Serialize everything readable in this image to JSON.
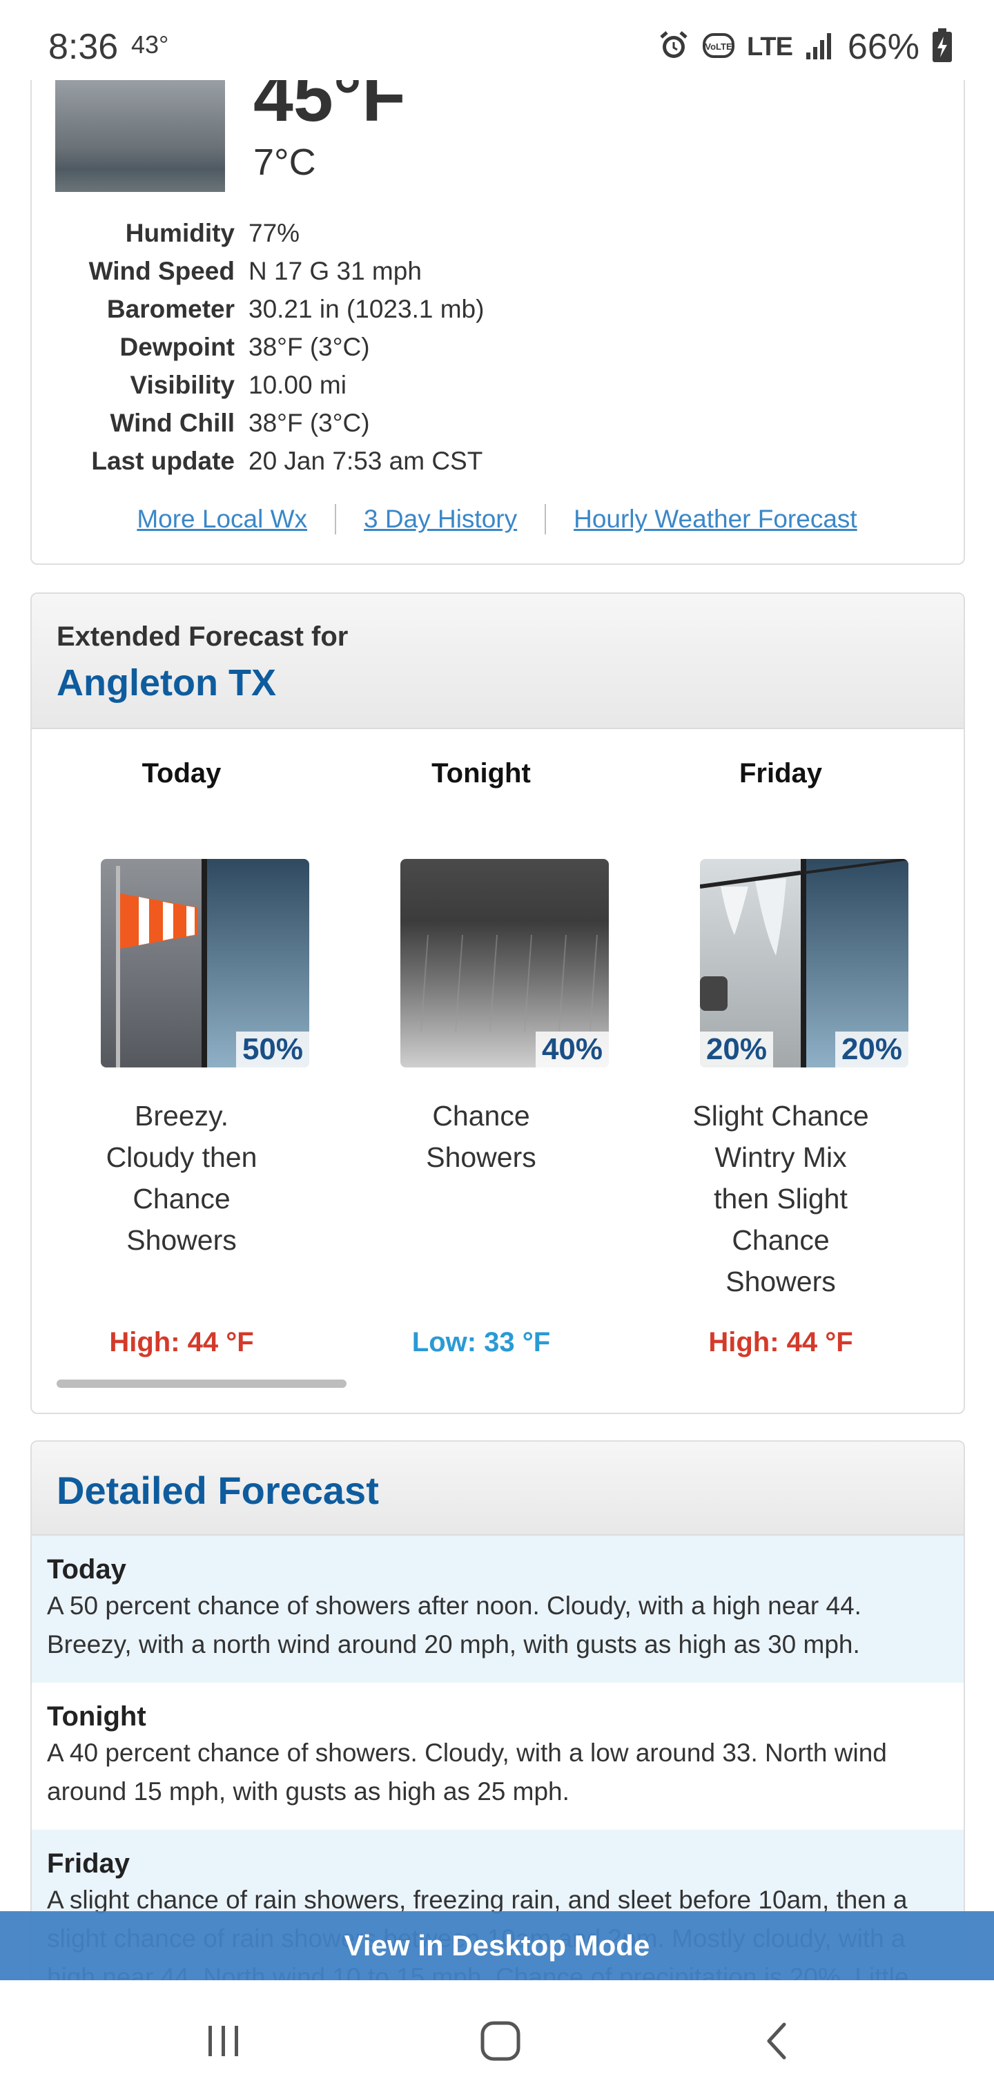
{
  "status_bar": {
    "time": "8:36",
    "temp": "43°",
    "network": "LTE",
    "battery": "66%",
    "volte": "VoLTE"
  },
  "current": {
    "temp_f": "45°F",
    "temp_c": "7°C",
    "details": [
      {
        "label": "Humidity",
        "value": "77%"
      },
      {
        "label": "Wind Speed",
        "value": "N 17 G 31 mph"
      },
      {
        "label": "Barometer",
        "value": "30.21 in (1023.1 mb)"
      },
      {
        "label": "Dewpoint",
        "value": "38°F (3°C)"
      },
      {
        "label": "Visibility",
        "value": "10.00 mi"
      },
      {
        "label": "Wind Chill",
        "value": "38°F (3°C)"
      },
      {
        "label": "Last update",
        "value": "20 Jan 7:53 am CST"
      }
    ],
    "links": [
      "More Local Wx",
      "3 Day History",
      "Hourly Weather Forecast"
    ]
  },
  "extended": {
    "heading": "Extended Forecast for",
    "location": "Angleton TX",
    "periods": [
      {
        "name": "Today",
        "desc_lines": [
          "Breezy.",
          "Cloudy then",
          "Chance",
          "Showers"
        ],
        "pops": [
          "50%"
        ],
        "temp": "High: 44 °F",
        "kind": "hi"
      },
      {
        "name": "Tonight",
        "desc_lines": [
          "Chance",
          "Showers"
        ],
        "pops": [
          "40%"
        ],
        "temp": "Low: 33 °F",
        "kind": "lo"
      },
      {
        "name": "Friday",
        "desc_lines": [
          "Slight Chance",
          "Wintry Mix",
          "then Slight",
          "Chance",
          "Showers"
        ],
        "pops": [
          "20%",
          "20%"
        ],
        "temp": "High: 44 °F",
        "kind": "hi"
      }
    ]
  },
  "detailed": {
    "title": "Detailed Forecast",
    "rows": [
      {
        "name": "Today",
        "text": "A 50 percent chance of showers after noon. Cloudy, with a high near 44. Breezy, with a north wind around 20 mph, with gusts as high as 30 mph."
      },
      {
        "name": "Tonight",
        "text": "A 40 percent chance of showers. Cloudy, with a low around 33. North wind around 15 mph, with gusts as high as 25 mph."
      },
      {
        "name": "Friday",
        "text": "A slight chance of rain showers, freezing rain, and sleet before 10am, then a slight chance of rain showers between 10am and 2pm. Mostly cloudy, with a high near 44. North wind 10 to 15 mph. Chance of precipitation is 20%. Little"
      }
    ]
  },
  "desktop_mode_label": "View in Desktop Mode",
  "colors": {
    "link": "#3a87c8",
    "location": "#0e5c9e",
    "high": "#d43a2a",
    "low": "#2a9ad4",
    "banner": "#4282c4"
  },
  "icons": [
    "alarm-icon",
    "signal-icon",
    "battery-charging-icon",
    "recent-apps-icon",
    "home-icon",
    "back-icon"
  ]
}
